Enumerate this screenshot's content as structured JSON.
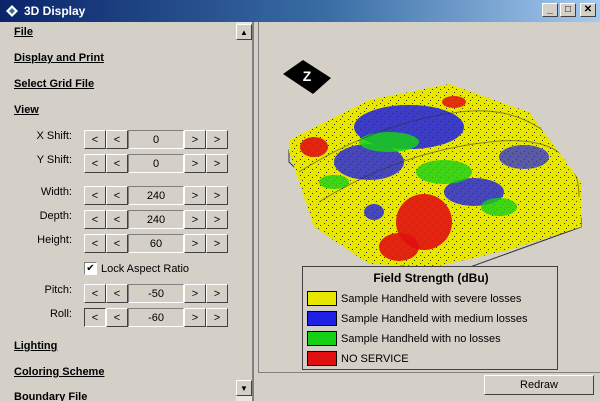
{
  "window": {
    "title": "3D Display"
  },
  "menu": {
    "file": "File",
    "display_print": "Display and Print",
    "select_grid": "Select Grid File",
    "view": "View",
    "lighting": "Lighting",
    "coloring": "Coloring Scheme",
    "boundary": "Boundary File"
  },
  "controls": {
    "x_shift": {
      "label": "X Shift:",
      "value": "0"
    },
    "y_shift": {
      "label": "Y Shift:",
      "value": "0"
    },
    "width": {
      "label": "Width:",
      "value": "240"
    },
    "depth": {
      "label": "Depth:",
      "value": "240"
    },
    "height": {
      "label": "Height:",
      "value": "60"
    },
    "lock_aspect": {
      "label": "Lock Aspect Ratio",
      "checked": true
    },
    "pitch": {
      "label": "Pitch:",
      "value": "-50"
    },
    "roll": {
      "label": "Roll:",
      "value": "-60"
    }
  },
  "buttons": {
    "dbl_left": "<",
    "left": "<",
    "right": ">",
    "dbl_right": ">",
    "redraw": "Redraw"
  },
  "legend": {
    "title": "Field Strength (dBu)",
    "items": [
      {
        "label": "Sample Handheld with severe losses",
        "color": "#e6e600"
      },
      {
        "label": "Sample Handheld with medium losses",
        "color": "#1f1fe6"
      },
      {
        "label": "Sample Handheld with no losses",
        "color": "#16d016"
      },
      {
        "label": "NO SERVICE",
        "color": "#e01010"
      }
    ]
  },
  "compass": {
    "letter": "Z"
  },
  "colors": {
    "title_bar": "#0a246a",
    "surface": "#d4d0c8"
  }
}
